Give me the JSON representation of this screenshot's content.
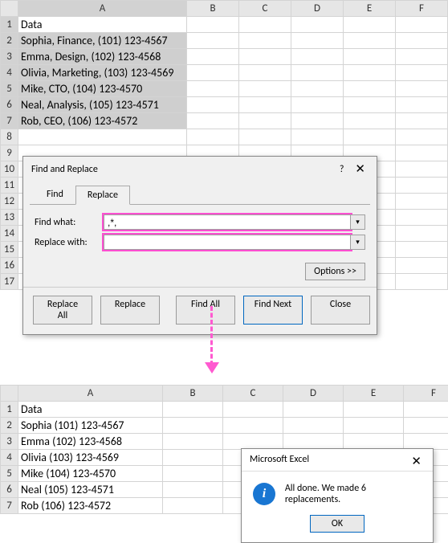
{
  "sheet1": {
    "cols": [
      "A",
      "B",
      "C",
      "D",
      "E",
      "F"
    ],
    "rows": {
      "1": "Data",
      "2": "Sophia, Finance, (101) 123-4567",
      "3": "Emma, Design, (102) 123-4568",
      "4": "Olivia, Marketing, (103) 123-4569",
      "5": "Mike, CTO, (104) 123-4570",
      "6": "Neal, Analysis, (105) 123-4571",
      "7": "Rob, CEO, (106) 123-4572"
    }
  },
  "dialog": {
    "title": "Find and Replace",
    "help": "?",
    "tabs": {
      "find": "Find",
      "replace": "Replace"
    },
    "find_label": "Find what:",
    "replace_label": "Replace with:",
    "find_value": ",*,",
    "replace_value": "",
    "options_btn": "Options >>",
    "buttons": {
      "replace_all": "Replace All",
      "replace": "Replace",
      "find_all": "Find All",
      "find_next": "Find Next",
      "close": "Close"
    }
  },
  "sheet2": {
    "cols": [
      "A",
      "B",
      "C",
      "D",
      "E",
      "F"
    ],
    "rows": {
      "1": "Data",
      "2": "Sophia (101) 123-4567",
      "3": "Emma (102) 123-4568",
      "4": "Olivia (103) 123-4569",
      "5": "Mike (104) 123-4570",
      "6": "Neal (105) 123-4571",
      "7": "Rob (106) 123-4572"
    }
  },
  "msgbox": {
    "title": "Microsoft Excel",
    "text": "All done. We made 6 replacements.",
    "ok": "OK"
  }
}
